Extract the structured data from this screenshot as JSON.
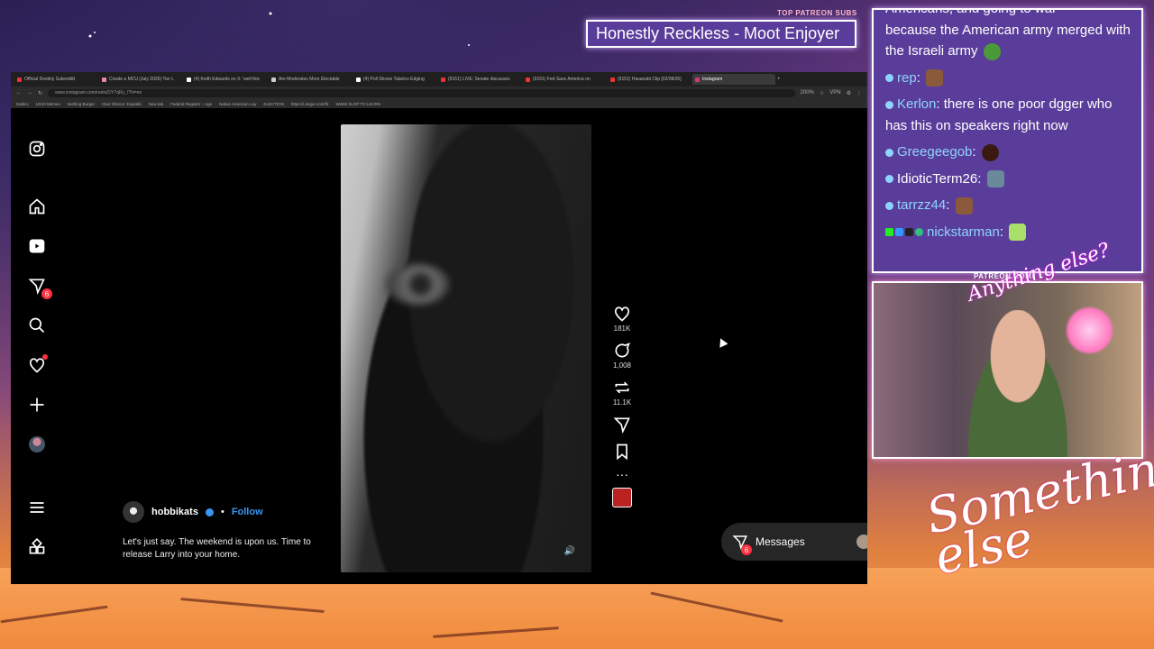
{
  "browser": {
    "tabs": [
      "Official Destiny Subreddit",
      "Create a MCU (July 2026) Tier L",
      "(4) Keith Edwards on X: 'well this",
      "Are Moderates More Electable",
      "(4) Poll Shows Talarico Edging",
      "(9151) LIVE: Senate discusses",
      "(9151) Fed Save America on",
      "(9151) Hasanabi Clip [02/08/26]",
      "Instagram"
    ],
    "url": "www.instagram.com/reels/DY7qRy_/?hl=en",
    "zoom": "200%",
    "vpn": "VPN",
    "bookmarks": [
      "Daltics",
      "10/10 Memes",
      "Nothing Burger",
      "Clair Obscur: Expediti",
      "New tab",
      "Federal Register :: Age",
      "Native American Lay",
      "ELECTION",
      "https://i.imgur.com/f3",
      "WWW SLOP TO LEARN"
    ]
  },
  "instagram": {
    "nav_badge": "6",
    "post": {
      "username": "hobbikats",
      "follow_label": "Follow",
      "separator": "•",
      "caption": "Let's just say. The weekend is upon us. Time to release Larry into your home."
    },
    "actions": {
      "likes": "181K",
      "comments": "1,008",
      "reposts": "11.1K"
    },
    "messages": {
      "label": "Messages",
      "badge": "6",
      "more": "···"
    }
  },
  "overlay": {
    "top_patreon_label": "TOP PATREON SUBS",
    "top_patreon_name": "Honestly Reckless - Moot Enjoyer",
    "patreon_url": "PATREON.COM/",
    "signature": "Anything else?",
    "logo": "Something else"
  },
  "chat": {
    "partial_top": "Americans, and going to war",
    "messages": [
      {
        "user": "",
        "text": "because the American army merged with the Israeli army"
      },
      {
        "user": "rep",
        "text": ""
      },
      {
        "user": "Kerlon",
        "text": "there is one poor dgger who has this on speakers right now"
      },
      {
        "user": "Greegeegob",
        "text": ""
      },
      {
        "user": "IdioticTerm26",
        "text": ""
      },
      {
        "user": "tarrzz44",
        "text": ""
      },
      {
        "user": "nickstarman",
        "text": ""
      }
    ]
  },
  "colors": {
    "accent_blue": "#3897f0",
    "notif_red": "#ff3040",
    "chat_bg": "#5a3d9a",
    "chat_user": "#8fd4ff"
  }
}
